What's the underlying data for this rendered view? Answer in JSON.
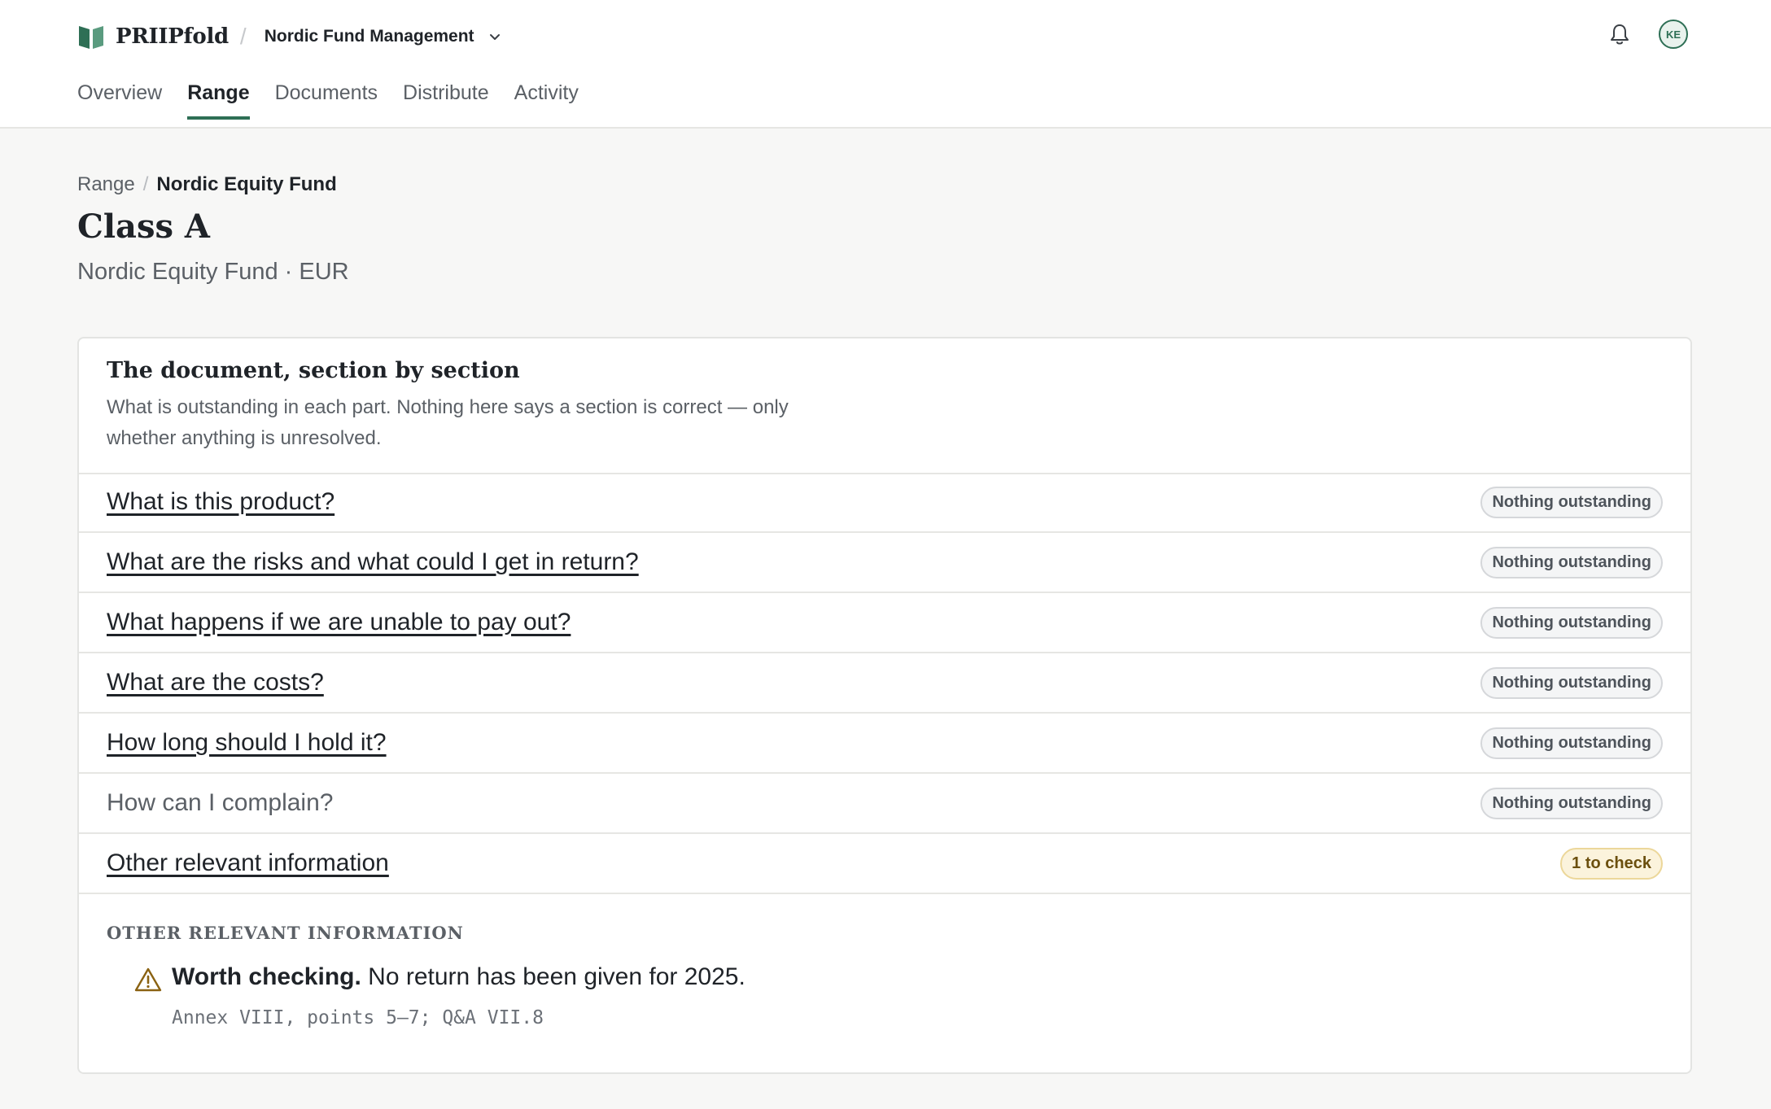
{
  "header": {
    "brand": "PRIIPfold",
    "brand_separator": "/",
    "org_name": "Nordic Fund Management",
    "avatar_initials": "KE",
    "accent_color": "#2e6f55"
  },
  "tabs": [
    {
      "label": "Overview",
      "active": false
    },
    {
      "label": "Range",
      "active": true
    },
    {
      "label": "Documents",
      "active": false
    },
    {
      "label": "Distribute",
      "active": false
    },
    {
      "label": "Activity",
      "active": false
    }
  ],
  "breadcrumb": {
    "parent": "Range",
    "separator": "/",
    "current": "Nordic Equity Fund"
  },
  "page": {
    "title": "Class A",
    "subtitle": "Nordic Equity Fund · EUR"
  },
  "card": {
    "title": "The document, section by section",
    "description": "What is outstanding in each part. Nothing here says a section is correct — only whether anything is unresolved.",
    "sections": [
      {
        "label": "What is this product?",
        "status": "Nothing outstanding",
        "linked": true
      },
      {
        "label": "What are the risks and what could I get in return?",
        "status": "Nothing outstanding",
        "linked": true
      },
      {
        "label": "What happens if we are unable to pay out?",
        "status": "Nothing outstanding",
        "linked": true
      },
      {
        "label": "What are the costs?",
        "status": "Nothing outstanding",
        "linked": true
      },
      {
        "label": "How long should I hold it?",
        "status": "Nothing outstanding",
        "linked": true
      },
      {
        "label": "How can I complain?",
        "status": "Nothing outstanding",
        "linked": false
      },
      {
        "label": "Other relevant information",
        "status": "1 to check",
        "linked": true
      }
    ],
    "detail": {
      "heading": "OTHER RELEVANT INFORMATION",
      "finding_strong": "Worth checking.",
      "finding_text": " No return has been given for 2025.",
      "reference": "Annex VIII, points 5–7; Q&A VII.8",
      "icon": "warning-triangle-icon"
    }
  }
}
